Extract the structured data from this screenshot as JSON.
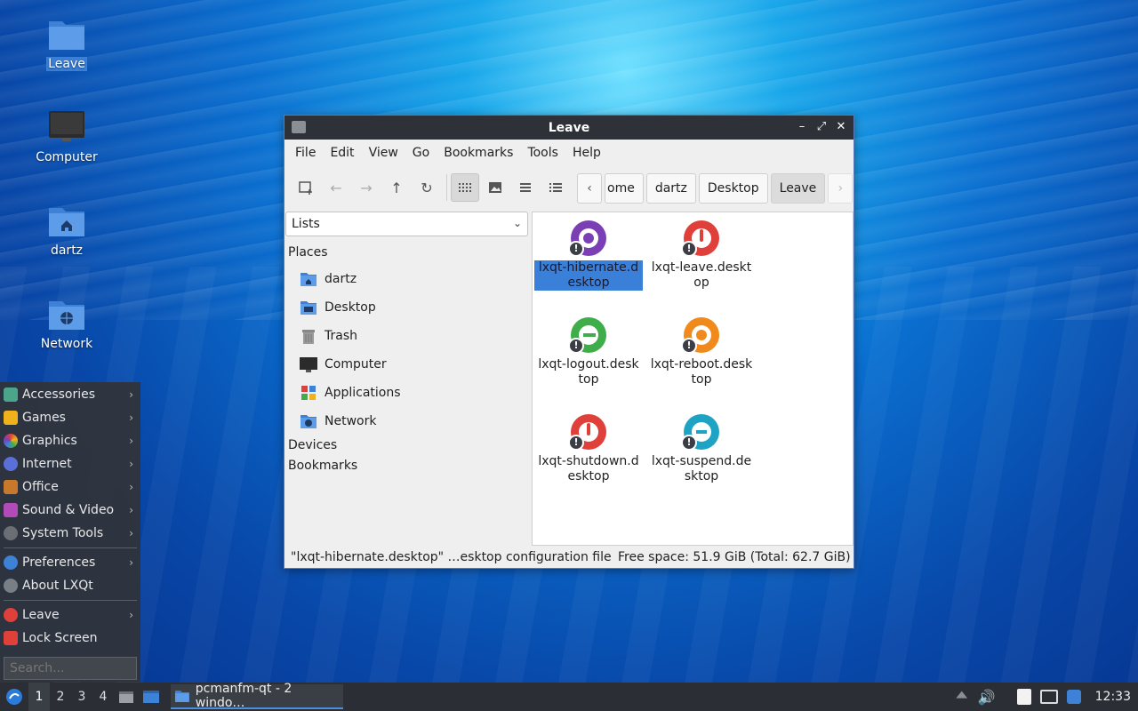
{
  "desktop": {
    "icons": [
      {
        "label": "Leave",
        "icon": "folder-icon"
      },
      {
        "label": "Computer",
        "icon": "monitor-icon"
      },
      {
        "label": "dartz",
        "icon": "home-folder-icon"
      },
      {
        "label": "Network",
        "icon": "network-folder-icon"
      }
    ]
  },
  "window": {
    "title": "Leave",
    "controls": {
      "minimize": "–",
      "maximize": "⤢",
      "close": "✕"
    },
    "menu": [
      "File",
      "Edit",
      "View",
      "Go",
      "Bookmarks",
      "Tools",
      "Help"
    ],
    "breadcrumbs": [
      "ome",
      "dartz",
      "Desktop",
      "Leave"
    ],
    "sidepane": {
      "selector": "Lists",
      "places_header": "Places",
      "places": [
        "dartz",
        "Desktop",
        "Trash",
        "Computer",
        "Applications",
        "Network"
      ],
      "devices_header": "Devices",
      "bookmarks_header": "Bookmarks"
    },
    "files": [
      {
        "name": "lxqt-hibernate.desktop",
        "selected": true,
        "color": "#7b3fb5"
      },
      {
        "name": "lxqt-leave.desktop",
        "selected": false,
        "color": "#e0403a"
      },
      {
        "name": "lxqt-logout.desktop",
        "selected": false,
        "color": "#3fae4a"
      },
      {
        "name": "lxqt-reboot.desktop",
        "selected": false,
        "color": "#f08a1c"
      },
      {
        "name": "lxqt-shutdown.desktop",
        "selected": false,
        "color": "#e0403a"
      },
      {
        "name": "lxqt-suspend.desktop",
        "selected": false,
        "color": "#1fa3c4"
      }
    ],
    "status": {
      "left": "\"lxqt-hibernate.desktop\" …esktop configuration file",
      "right": "Free space: 51.9 GiB (Total: 62.7 GiB)"
    }
  },
  "startmenu": {
    "categories": [
      "Accessories",
      "Games",
      "Graphics",
      "Internet",
      "Office",
      "Sound & Video",
      "System Tools"
    ],
    "settings": [
      "Preferences",
      "About LXQt"
    ],
    "session": [
      "Leave",
      "Lock Screen"
    ],
    "search_placeholder": "Search..."
  },
  "taskbar": {
    "desktops": [
      "1",
      "2",
      "3",
      "4"
    ],
    "active_desktop": "1",
    "task_label": "pcmanfm-qt - 2 windo…",
    "clock": "12:33"
  }
}
